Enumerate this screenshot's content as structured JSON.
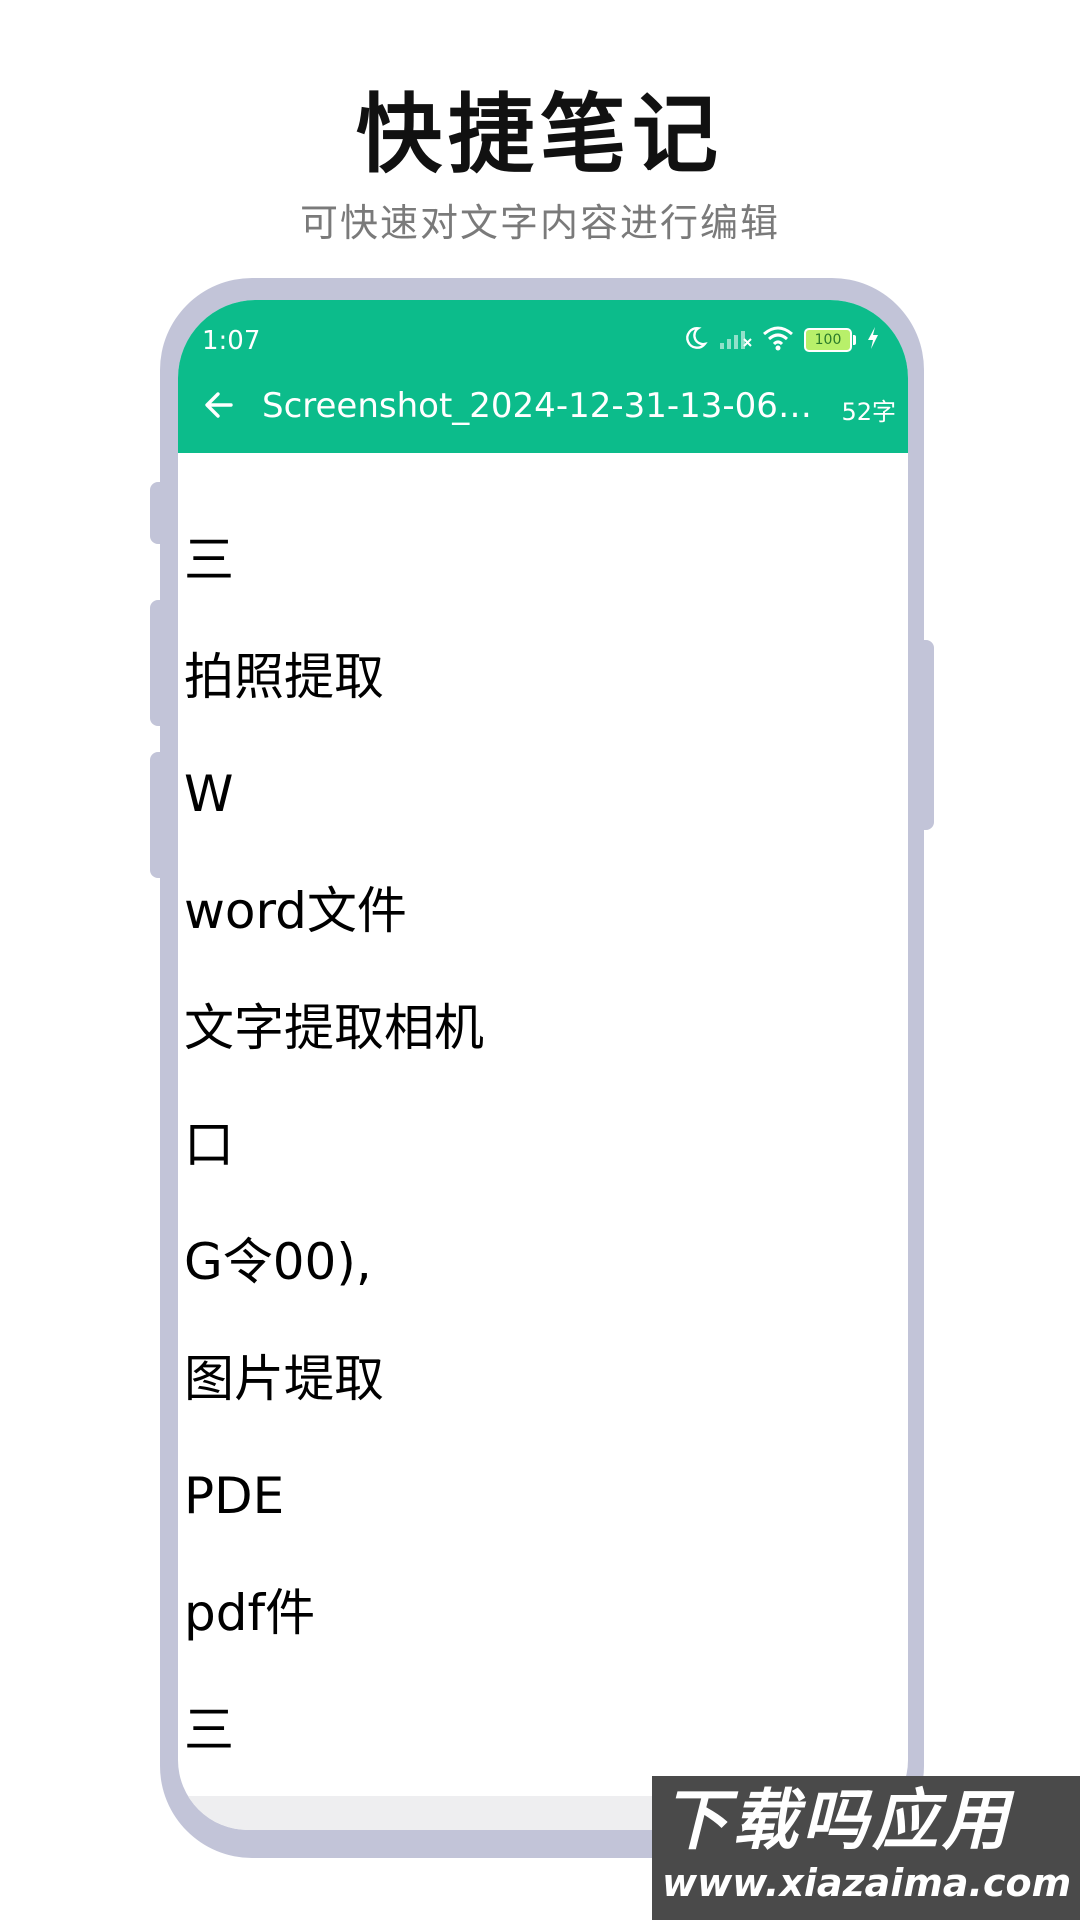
{
  "header": {
    "title": "快捷笔记",
    "subtitle": "可快速对文字内容进行编辑"
  },
  "status_bar": {
    "time": "1:07",
    "battery": "100",
    "icons": [
      "moon-icon",
      "signal-icon",
      "wifi-icon",
      "battery-icon",
      "charging-icon"
    ]
  },
  "toolbar": {
    "back_icon": "arrow-left-icon",
    "title": "Screenshot_2024-12-31-13-06-4...",
    "word_count": "52字"
  },
  "note": {
    "lines": [
      "三",
      "拍照提取",
      "W",
      "word文件",
      "文字提取相机",
      "口",
      "G令00),",
      "图片堤取",
      "PDE",
      "pdf件",
      "三"
    ]
  },
  "watermark": {
    "cn": "下载吗应用",
    "url": "www.xiazaima.com"
  },
  "colors": {
    "accent": "#0cbc8b",
    "frame": "#c2c4d8",
    "subtitle": "#7a7a7a"
  }
}
